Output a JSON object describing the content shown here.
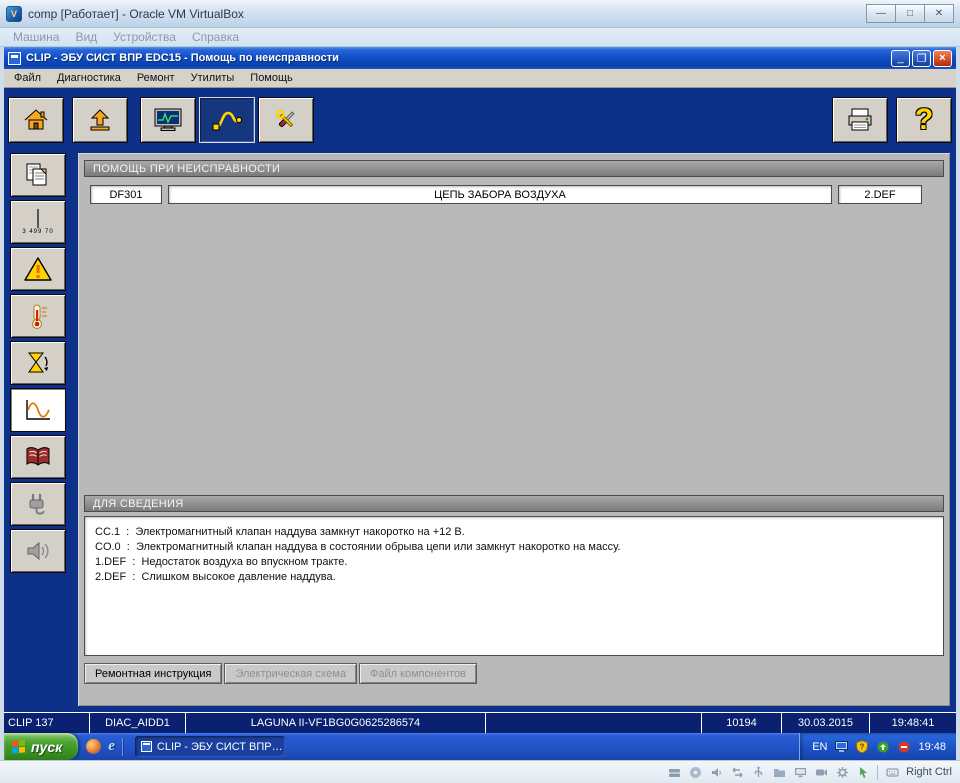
{
  "host": {
    "title": "comp [Работает] - Oracle VM VirtualBox",
    "menu": [
      "Машина",
      "Вид",
      "Устройства",
      "Справка"
    ],
    "host_key": "Right Ctrl"
  },
  "app": {
    "title": "CLIP - ЭБУ СИСТ ВПР EDC15 - Помощь по неисправности",
    "menu": [
      "Файл",
      "Диагностика",
      "Ремонт",
      "Утилиты",
      "Помощь"
    ],
    "barcode_label": "3 499 70",
    "panel": {
      "header": "ПОМОЩЬ ПРИ НЕИСПРАВНОСТИ",
      "fault_code": "DF301",
      "fault_label": "ЦЕПЬ ЗАБОРА ВОЗДУХА",
      "fault_status": "2.DEF",
      "info_header": "ДЛЯ СВЕДЕНИЯ",
      "info_lines": [
        "CC.1  :  Электромагнитный клапан наддува замкнут накоротко на +12 В.",
        "CO.0  :  Электромагнитный клапан наддува в состоянии обрыва цепи или замкнут накоротко на массу.",
        "1.DEF  :  Недостаток воздуха во впускном тракте.",
        "2.DEF  :  Слишком высокое давление наддува."
      ],
      "tabs": [
        "Ремонтная инструкция",
        "Электрическая схема",
        "Файл компонентов"
      ]
    },
    "status": {
      "tool": "CLIP 137",
      "module": "DIAC_AIDD1",
      "vehicle": "LAGUNA II-VF1BG0G0625286574",
      "code": "10194",
      "date": "30.03.2015",
      "time": "19:48:41"
    }
  },
  "taskbar": {
    "start": "пуск",
    "task": "CLIP - ЭБУ СИСТ ВПР…",
    "lang": "EN",
    "clock": "19:48"
  }
}
